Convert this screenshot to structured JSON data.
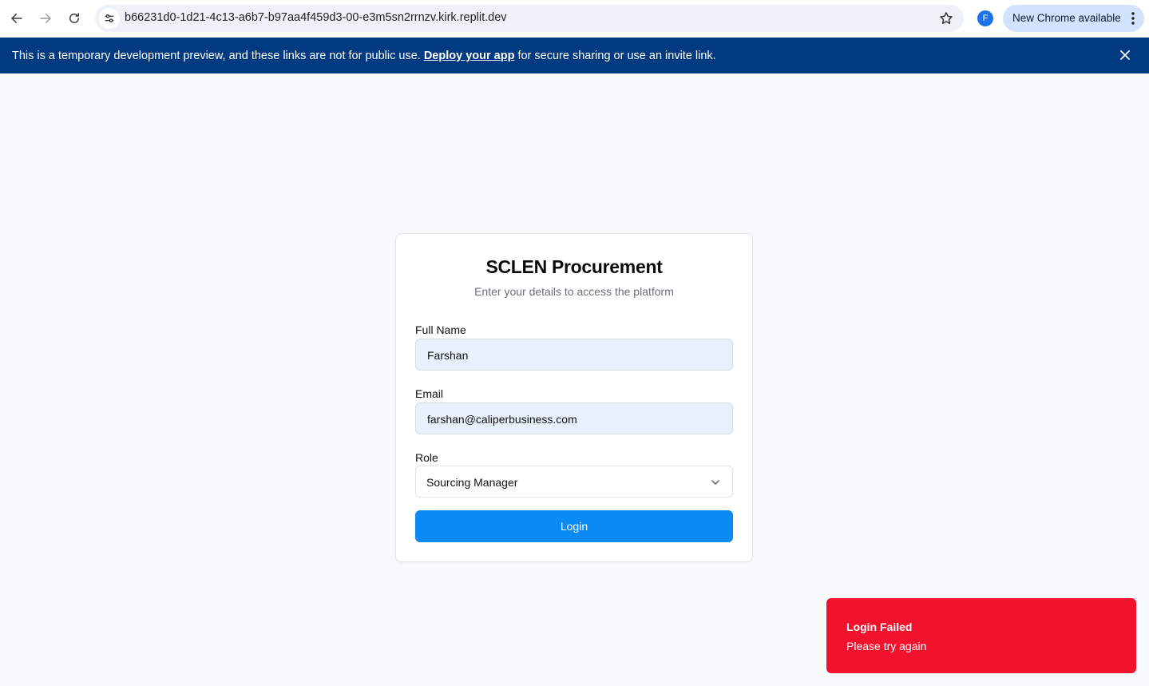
{
  "browser": {
    "url": "b66231d0-1d21-4c13-a6b7-b97aa4f459d3-00-e3m5sn2rrnzv.kirk.replit.dev",
    "profile_initial": "F",
    "update_label": "New Chrome available"
  },
  "banner": {
    "text_before": "This is a temporary development preview, and these links are not for public use.",
    "link_text": "Deploy your app",
    "text_after": "for secure sharing or use an invite link."
  },
  "login": {
    "title": "SCLEN Procurement",
    "subtitle": "Enter your details to access the platform",
    "full_name_label": "Full Name",
    "full_name_value": "Farshan",
    "email_label": "Email",
    "email_value": "farshan@caliperbusiness.com",
    "role_label": "Role",
    "role_value": "Sourcing Manager",
    "button_label": "Login"
  },
  "toast": {
    "title": "Login Failed",
    "description": "Please try again",
    "color": "#f2122e"
  },
  "colors": {
    "banner_bg": "#003a80",
    "primary_button": "#0a8af2"
  }
}
